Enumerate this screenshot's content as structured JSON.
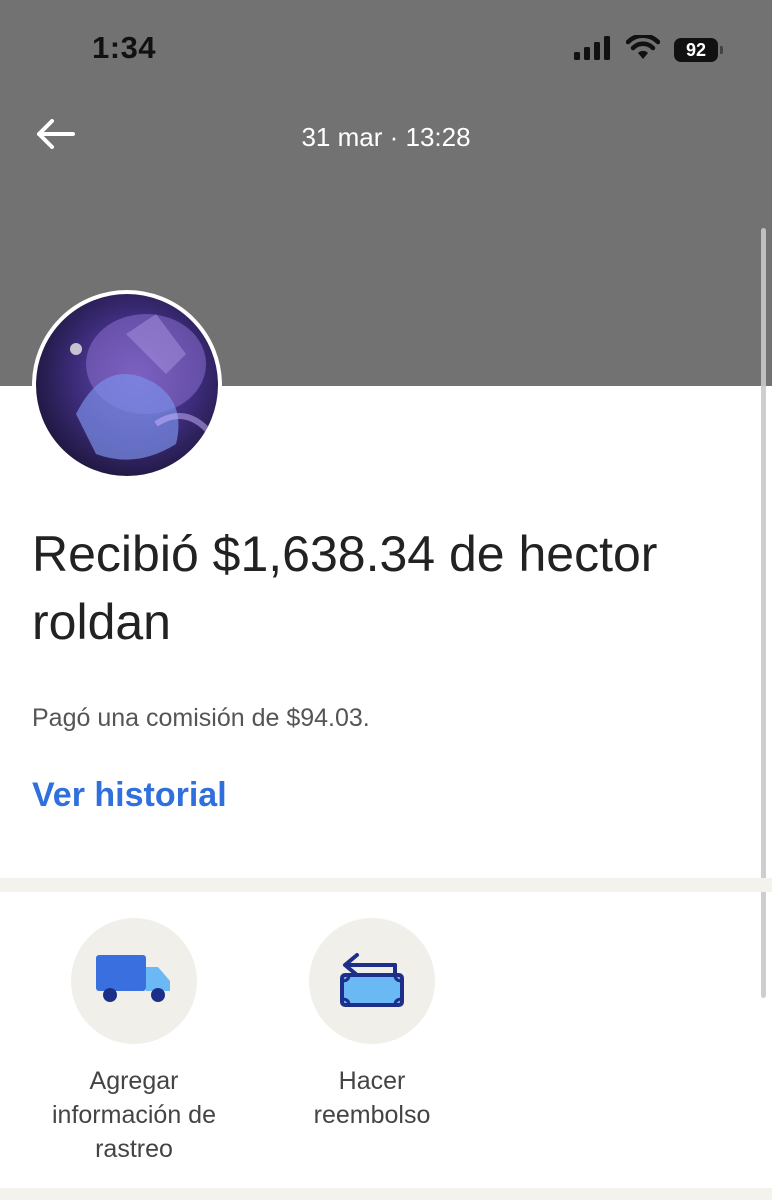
{
  "status_bar": {
    "time": "1:34",
    "battery": "92",
    "icons": [
      "cellular-signal-icon",
      "wifi-icon",
      "battery-icon"
    ]
  },
  "header": {
    "back_icon": "arrow-left-icon",
    "date": "31 mar · 13:28"
  },
  "transaction": {
    "title": "Recibió $1,638.34 de hector roldan",
    "fee": "Pagó una comisión de $94.03.",
    "history_link": "Ver historial"
  },
  "actions": [
    {
      "icon": "truck-icon",
      "label": "Agregar información de rastreo"
    },
    {
      "icon": "refund-icon",
      "label": "Hacer reembolso"
    }
  ],
  "colors": {
    "header_bg": "#727272",
    "link_blue": "#2f6fde",
    "band_bg": "#f4f2ed",
    "icon_blue": "#3a6fe0",
    "icon_light_blue": "#6ab8f4",
    "icon_navy": "#1e2f8a"
  }
}
